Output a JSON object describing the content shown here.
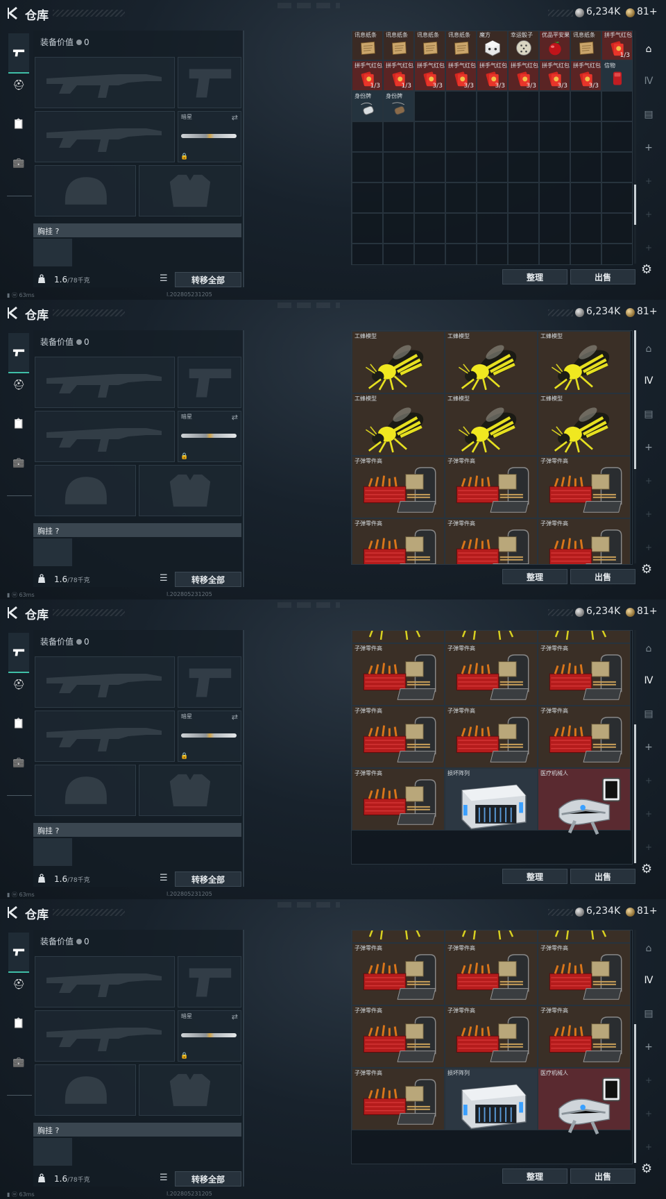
{
  "header": {
    "title": "仓库",
    "currency_silver": "6,234K",
    "currency_gold": "81+"
  },
  "equipment": {
    "value_label": "装备价值",
    "value": "0",
    "melee_label": "暗星",
    "chest_label": "胸挂 ?",
    "weight_value": "1.6",
    "weight_capacity": "/78千克",
    "transfer_all": "转移全部"
  },
  "actions": {
    "sort": "整理",
    "sell": "出售"
  },
  "status": {
    "ping": "63ms",
    "build": "l.202805231205"
  },
  "frame1_items": [
    {
      "label": "讯息纸条",
      "type": "note"
    },
    {
      "label": "讯息纸条",
      "type": "note"
    },
    {
      "label": "讯息纸条",
      "type": "note"
    },
    {
      "label": "讯息纸条",
      "type": "note"
    },
    {
      "label": "魔方",
      "type": "cube"
    },
    {
      "label": "幸运骰子",
      "type": "dice"
    },
    {
      "label": "优品平安果",
      "type": "apple"
    },
    {
      "label": "讯息纸条",
      "type": "note"
    },
    {
      "label": "拼手气红包",
      "type": "redpack",
      "count": "1/3"
    },
    {
      "label": "拼手气红包",
      "type": "redpack",
      "count": "1/3"
    },
    {
      "label": "拼手气红包",
      "type": "redpack",
      "count": "1/3"
    },
    {
      "label": "拼手气红包",
      "type": "redpack",
      "count": "3/3"
    },
    {
      "label": "拼手气红包",
      "type": "redpack",
      "count": "3/3"
    },
    {
      "label": "拼手气红包",
      "type": "redpack",
      "count": "3/3"
    },
    {
      "label": "拼手气红包",
      "type": "redpack",
      "count": "3/3"
    },
    {
      "label": "拼手气红包",
      "type": "redpack",
      "count": "3/3"
    },
    {
      "label": "拼手气红包",
      "type": "redpack",
      "count": "3/3"
    },
    {
      "label": "信物",
      "type": "token"
    },
    {
      "label": "身份牌",
      "type": "tag"
    },
    {
      "label": "身份牌",
      "type": "tag2"
    }
  ],
  "frame2_items": [
    {
      "label": "工蜂模型",
      "type": "bee"
    },
    {
      "label": "工蜂模型",
      "type": "bee"
    },
    {
      "label": "工蜂模型",
      "type": "bee"
    },
    {
      "label": "工蜂模型",
      "type": "bee"
    },
    {
      "label": "工蜂模型",
      "type": "bee"
    },
    {
      "label": "工蜂模型",
      "type": "bee"
    },
    {
      "label": "子弹零件高",
      "type": "ammo"
    },
    {
      "label": "子弹零件高",
      "type": "ammo"
    },
    {
      "label": "子弹零件高",
      "type": "ammo"
    },
    {
      "label": "子弹零件高",
      "type": "ammo"
    },
    {
      "label": "子弹零件高",
      "type": "ammo"
    },
    {
      "label": "子弹零件高",
      "type": "ammo"
    }
  ],
  "frame3_items": [
    {
      "label": "",
      "type": "bee-partial"
    },
    {
      "label": "",
      "type": "bee-partial"
    },
    {
      "label": "",
      "type": "bee-partial"
    },
    {
      "label": "子弹零件高",
      "type": "ammo"
    },
    {
      "label": "子弹零件高",
      "type": "ammo"
    },
    {
      "label": "子弹零件高",
      "type": "ammo"
    },
    {
      "label": "子弹零件高",
      "type": "ammo"
    },
    {
      "label": "子弹零件高",
      "type": "ammo"
    },
    {
      "label": "子弹零件高",
      "type": "ammo"
    },
    {
      "label": "子弹零件高",
      "type": "ammo"
    },
    {
      "label": "损坏阵列",
      "type": "array"
    },
    {
      "label": "医疗机械人",
      "type": "robot"
    }
  ],
  "scroll_positions": [
    0.8,
    0.0,
    1.0,
    1.0
  ],
  "colors": {
    "accent": "#3fbfa7",
    "rare_red": "#5a2a2a",
    "legendary": "#4a3a2a"
  }
}
